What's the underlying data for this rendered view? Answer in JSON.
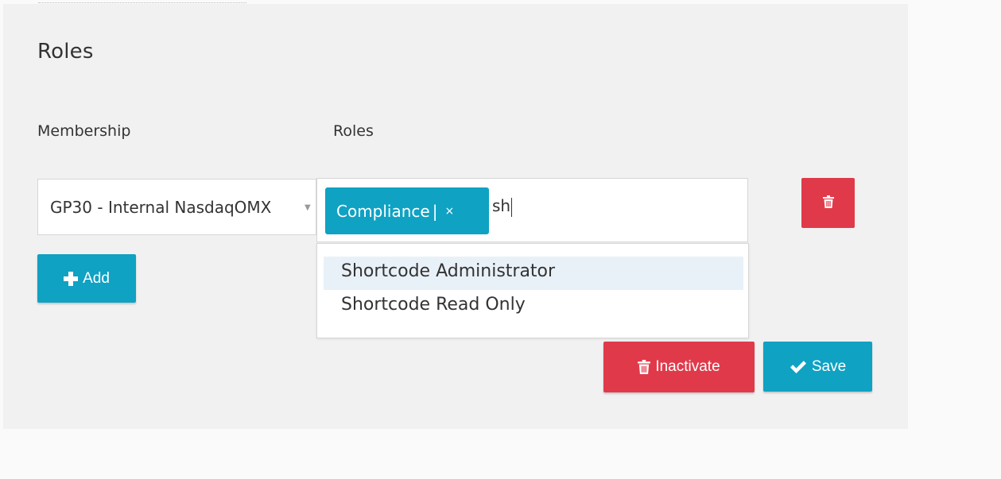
{
  "section": {
    "title": "Roles"
  },
  "columns": {
    "membership_label": "Membership",
    "roles_label": "Roles"
  },
  "membership": {
    "value": "GP30 - Internal NasdaqOMX"
  },
  "roles": {
    "chips": [
      {
        "label": "Compliance",
        "separator": "|",
        "remove": "×"
      }
    ],
    "typed": "sh"
  },
  "dropdown": {
    "options": [
      {
        "label": "Shortcode Administrator",
        "highlighted": true
      },
      {
        "label": "Shortcode Read Only",
        "highlighted": false
      }
    ]
  },
  "buttons": {
    "add_label": "Add",
    "inactivate_label": "Inactivate",
    "save_label": "Save"
  },
  "icons": {
    "add": "plus-icon",
    "delete": "trash-icon",
    "save": "check-icon"
  },
  "colors": {
    "primary": "#0fa2c3",
    "danger": "#e03a4a",
    "panel": "#f1f1f1",
    "highlight": "#e9f1f8"
  }
}
